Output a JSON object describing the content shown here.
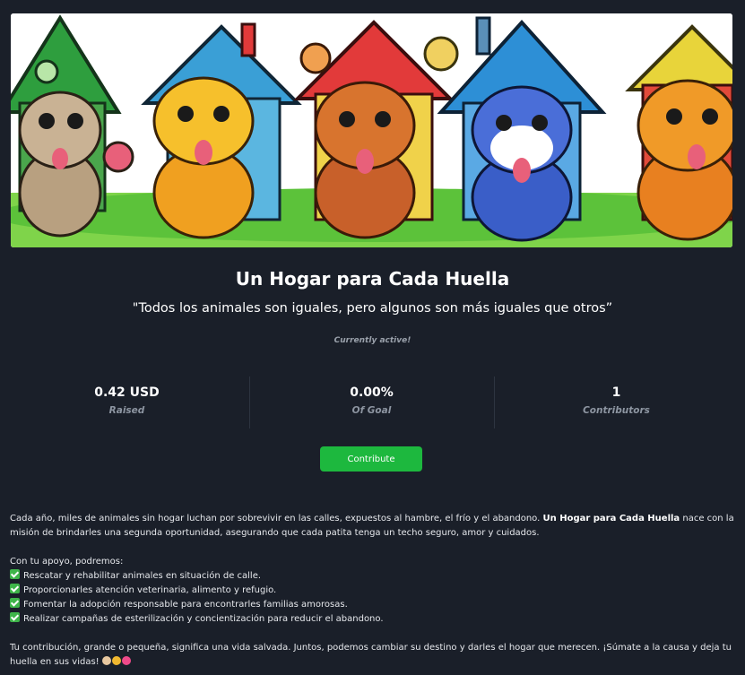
{
  "campaign": {
    "title": "Un Hogar para Cada Huella",
    "quote": "\"Todos los animales son iguales, pero algunos son más iguales que otros”",
    "status": "Currently active!"
  },
  "stats": [
    {
      "value": "0.42 USD",
      "label": "Raised"
    },
    {
      "value": "0.00%",
      "label": "Of Goal"
    },
    {
      "value": "1",
      "label": "Contributors"
    }
  ],
  "contribute_label": "Contribute",
  "description": {
    "p1_before": "Cada año, miles de animales sin hogar luchan por sobrevivir en las calles, expuestos al hambre, el frío y el abandono. ",
    "p1_bold": "Un Hogar para Cada Huella",
    "p1_after": " nace con la misión de brindarles una segunda oportunidad, asegurando que cada patita tenga un techo seguro, amor y cuidados.",
    "support_intro": "Con tu apoyo, podremos:",
    "items": [
      "Rescatar y rehabilitar animales en situación de calle.",
      "Proporcionarles atención veterinaria, alimento y refugio.",
      "Fomentar la adopción responsable para encontrarles familias amorosas.",
      "Realizar campañas de esterilización y concientización para reducir el abandono."
    ],
    "closing": "Tu contribución, grande o pequeña, significa una vida salvada. Juntos, podemos cambiar su destino y darles el hogar que merecen. ¡Súmate a la causa y deja tu huella en sus vidas!"
  },
  "colors": {
    "background": "#1a1f29",
    "accent_green": "#1db83e",
    "muted_text": "#8d95a1"
  }
}
